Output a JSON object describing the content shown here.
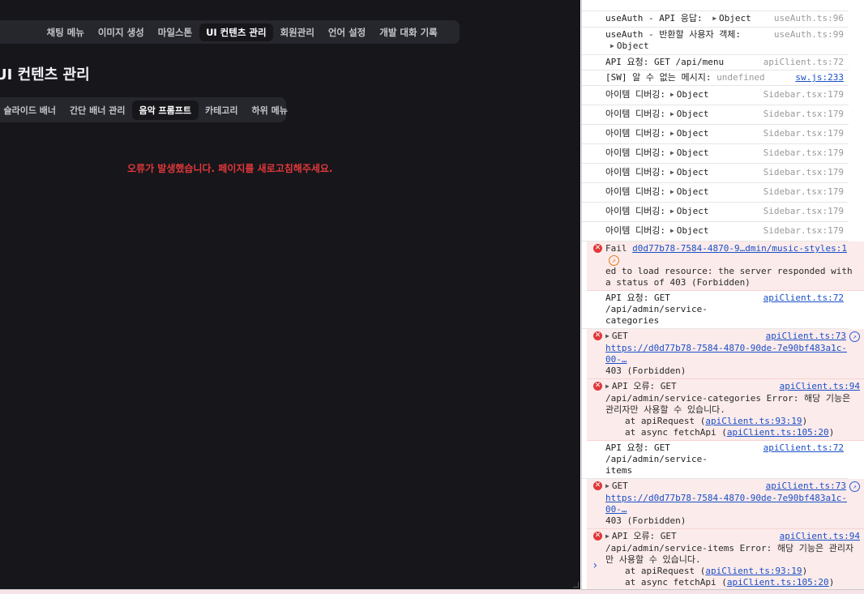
{
  "app": {
    "top_nav": [
      "채팅 메뉴",
      "이미지 생성",
      "마일스톤",
      "UI 컨텐츠 관리",
      "회원관리",
      "언어 설정",
      "개발 대화 기록"
    ],
    "top_nav_active": "UI 컨텐츠 관리",
    "page_title": "UI 컨텐츠 관리",
    "sub_tabs": [
      "슬라이드 배너",
      "간단 배너 관리",
      "음악 프롬프트",
      "카테고리",
      "하위 메뉴"
    ],
    "sub_tab_active": "음악 프롬프트",
    "error_message": "오류가 발생했습니다. 페이지를 새로고침해주세요."
  },
  "console": {
    "log1": {
      "text": "useAuth - API 응답:",
      "obj": "Object",
      "src": "useAuth.ts:96"
    },
    "log2": {
      "text": "useAuth - 반환할 사용자 객체:",
      "obj": "Object",
      "src": "useAuth.ts:99"
    },
    "log3": {
      "text": "API 요청: GET /api/menu",
      "src": "apiClient.ts:72"
    },
    "log4": {
      "text": "[SW] 알 수 없는 메시지:",
      "value": "undefined",
      "src": "sw.js:233"
    },
    "debug_label": "아이템 디버깅:",
    "debug_obj": "Object",
    "debug_src": "Sidebar.tsx:179",
    "err1": {
      "link": "d0d77b78-7584-4870-9…dmin/music-styles:1",
      "prefix": "Fail",
      "text": "ed to load resource: the server responded with a status of 403 (Forbidden)"
    },
    "log5": {
      "line1": "API 요청: GET /api/admin/service-",
      "line2": "categories",
      "src": "apiClient.ts:72"
    },
    "err2": {
      "method": "GET",
      "src": "apiClient.ts:73",
      "url": "https://d0d77b78-7584-4870-90de-7e90bf483a1c-00-…",
      "status": "403 (Forbidden)"
    },
    "err3": {
      "line1": "API 오류: GET",
      "src": "apiClient.ts:94",
      "line2": "/api/admin/service-categories Error: 해당 기능은",
      "line3": "관리자만 사용할 수 있습니다.",
      "at1_prefix": "at apiRequest (",
      "at1_link": "apiClient.ts:93:19",
      "at2_prefix": "at async fetchApi (",
      "at2_link": "apiClient.ts:105:20"
    },
    "log6": {
      "line1": "API 요청: GET /api/admin/service-",
      "line2": "items",
      "src": "apiClient.ts:72"
    },
    "err4": {
      "method": "GET",
      "src": "apiClient.ts:73",
      "url": "https://d0d77b78-7584-4870-90de-7e90bf483a1c-00-…",
      "status": "403 (Forbidden)"
    },
    "err5": {
      "line1": "API 오류: GET",
      "src": "apiClient.ts:94",
      "line2": "/api/admin/service-items Error: 해당 기능은 관리자",
      "line3": "만 사용할 수 있습니다.",
      "at1_prefix": "at apiRequest (",
      "at1_link": "apiClient.ts:93:19",
      "at2_prefix": "at async fetchApi (",
      "at2_link": "apiClient.ts:105:20"
    }
  }
}
